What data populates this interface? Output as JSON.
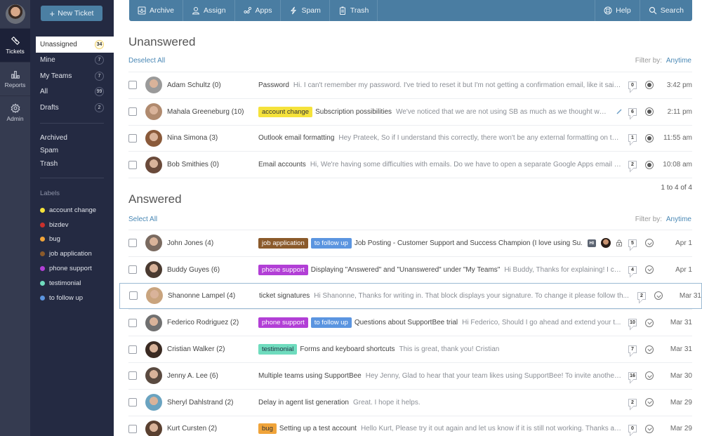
{
  "rail": {
    "items": [
      {
        "label": "Tickets",
        "icon": "ticket-icon",
        "active": true
      },
      {
        "label": "Reports",
        "icon": "bar-chart-icon"
      },
      {
        "label": "Admin",
        "icon": "gear-icon"
      }
    ]
  },
  "sidebar": {
    "new_ticket_label": "New Ticket",
    "folders": [
      {
        "label": "Unassigned",
        "count": "34",
        "active": true
      },
      {
        "label": "Mine",
        "count": "7"
      },
      {
        "label": "My Teams",
        "count": "7"
      },
      {
        "label": "All",
        "count": "99"
      },
      {
        "label": "Drafts",
        "count": "2"
      }
    ],
    "other_folders": [
      {
        "label": "Archived"
      },
      {
        "label": "Spam"
      },
      {
        "label": "Trash"
      }
    ],
    "labels_title": "Labels",
    "labels": [
      {
        "label": "account change",
        "color": "#f5e23b"
      },
      {
        "label": "bizdev",
        "color": "#c9302c"
      },
      {
        "label": "bug",
        "color": "#f0a43a"
      },
      {
        "label": "job application",
        "color": "#8b5a2b"
      },
      {
        "label": "phone support",
        "color": "#b23fd6"
      },
      {
        "label": "testimonial",
        "color": "#6fdcbe"
      },
      {
        "label": "to follow up",
        "color": "#5b95e0"
      }
    ]
  },
  "toolbar": {
    "archive": "Archive",
    "assign": "Assign",
    "apps": "Apps",
    "spam": "Spam",
    "trash": "Trash",
    "help": "Help",
    "search": "Search"
  },
  "unanswered": {
    "title": "Unanswered",
    "select_link": "Deselect All",
    "filter_label": "Filter by:",
    "filter_value": "Anytime",
    "pager": "1 to 4 of 4",
    "rows": [
      {
        "name": "Adam Schultz (0)",
        "tags": [],
        "subject": "Password",
        "preview": "Hi. I can't remember my password. I've tried to reset it but I'm not getting a confirmation email, like it said I...",
        "count": "0",
        "status": "open",
        "time": "3:42 pm",
        "avatar": "#9a9a9a"
      },
      {
        "name": "Mahala Greeneburg (10)",
        "tags": [
          {
            "label": "account change",
            "bg": "#f5e23b",
            "fg": "#333"
          }
        ],
        "subject": "Subscription possibilities",
        "preview": "We've noticed that we are not using SB as much as we thought we th...",
        "draft": true,
        "count": "6",
        "status": "open",
        "time": "2:11 pm",
        "avatar": "#b08a6e"
      },
      {
        "name": "Nina Simona (3)",
        "tags": [],
        "subject": "Outlook email formatting",
        "preview": "Hey Prateek, So if I understand this correctly, there won't be any external formatting on the...",
        "count": "1",
        "status": "open",
        "time": "11:55 am",
        "avatar": "#8a5a3a"
      },
      {
        "name": "Bob Smithies (0)",
        "tags": [],
        "subject": "Email accounts",
        "preview": "Hi, We're having some difficulties with emails. Do we have to open a separate Google Apps email accou...",
        "count": "2",
        "status": "open",
        "time": "10:08 am",
        "avatar": "#6a4a3a"
      }
    ]
  },
  "answered": {
    "title": "Answered",
    "select_link": "Select All",
    "filter_label": "Filter by:",
    "filter_value": "Anytime",
    "rows": [
      {
        "name": "John Jones (4)",
        "tags": [
          {
            "label": "job application",
            "bg": "#8b5a2b",
            "fg": "#fff"
          },
          {
            "label": "to follow up",
            "bg": "#5b95e0",
            "fg": "#fff"
          }
        ],
        "subject": "Job Posting - Customer Support and Success Champion (I love using Su...",
        "preview": "",
        "extra": {
          "hi": "HI",
          "agent": true,
          "lock": true
        },
        "count": "5",
        "status": "done",
        "time": "Apr 1",
        "avatar": "#7a6a60"
      },
      {
        "name": "Buddy Guyes (6)",
        "tags": [
          {
            "label": "phone support",
            "bg": "#b23fd6",
            "fg": "#fff"
          }
        ],
        "subject": "Displaying  \"Answered\" and \"Unanswered\" under \"My Teams\"",
        "preview": "Hi Buddy, Thanks for explaining! I ca...",
        "count": "4",
        "status": "done",
        "time": "Apr 1",
        "avatar": "#4a3a30"
      },
      {
        "name": "Shanonne Lampel (4)",
        "tags": [],
        "subject": "ticket signatures",
        "preview": "Hi Shanonne, Thanks for writing in. That block displays your signature. To change it please follow th...",
        "count": "2",
        "status": "done",
        "time": "Mar 31",
        "avatar": "#c9a47e",
        "highlight": true
      },
      {
        "name": "Federico Rodriguez (2)",
        "tags": [
          {
            "label": "phone support",
            "bg": "#b23fd6",
            "fg": "#fff"
          },
          {
            "label": "to follow up",
            "bg": "#5b95e0",
            "fg": "#fff"
          }
        ],
        "subject": "Questions about SupportBee trial",
        "preview": "Hi Federico, Should I go ahead and extend your t...",
        "count": "10",
        "status": "done",
        "time": "Mar 31",
        "avatar": "#707070"
      },
      {
        "name": "Cristian Walker  (2)",
        "tags": [
          {
            "label": "testimonial",
            "bg": "#6fdcbe",
            "fg": "#234"
          }
        ],
        "subject": "Forms and keyboard shortcuts",
        "preview": "This is great, thank you! Cristian",
        "count": "7",
        "status": "done",
        "time": "Mar 31",
        "avatar": "#3a2a22"
      },
      {
        "name": "Jenny A. Lee (6)",
        "tags": [],
        "subject": "Multiple teams using SupportBee",
        "preview": "Hey Jenny, Glad to hear that your team likes using SupportBee! To invite another de...",
        "count": "16",
        "status": "done",
        "time": "Mar 30",
        "avatar": "#5a4a40"
      },
      {
        "name": "Sheryl Dahlstrand (2)",
        "tags": [],
        "subject": "Delay in agent list generation",
        "preview": "Great. I hope it helps.",
        "count": "2",
        "status": "done",
        "time": "Mar 29",
        "avatar": "#6aa3c0"
      },
      {
        "name": "Kurt Cursten (2)",
        "tags": [
          {
            "label": "bug",
            "bg": "#f0a43a",
            "fg": "#333"
          }
        ],
        "subject": "Setting up a test account",
        "preview": "Hello Kurt, Please try it out again and let us know if it is still not working. Thanks ag...",
        "count": "0",
        "status": "done",
        "time": "Mar 29",
        "avatar": "#5a4030"
      }
    ]
  }
}
